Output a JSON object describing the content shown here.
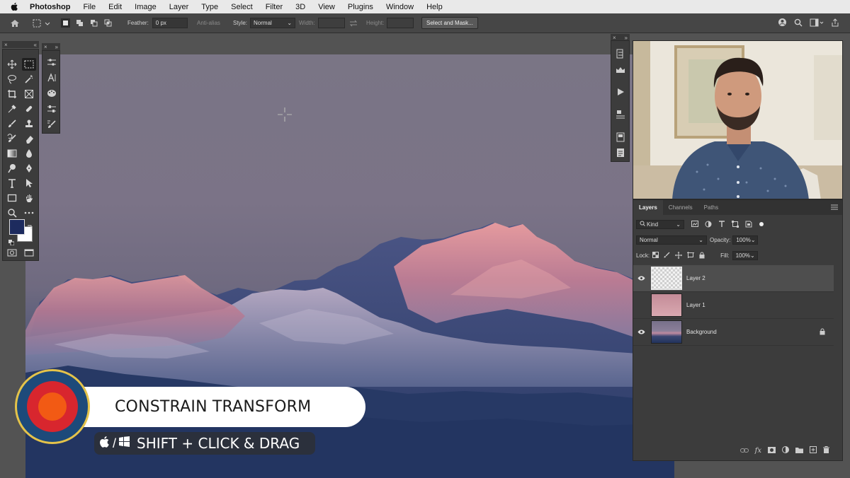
{
  "menubar": {
    "app_name": "Photoshop",
    "items": [
      "File",
      "Edit",
      "Image",
      "Layer",
      "Type",
      "Select",
      "Filter",
      "3D",
      "View",
      "Plugins",
      "Window",
      "Help"
    ]
  },
  "options_bar": {
    "feather_label": "Feather:",
    "feather_value": "0 px",
    "anti_alias_label": "Anti-alias",
    "style_label": "Style:",
    "style_value": "Normal",
    "width_label": "Width:",
    "height_label": "Height:",
    "select_mask_label": "Select and Mask..."
  },
  "tools": {
    "left_column": [
      "move-tool",
      "lasso-tool",
      "crop-tool",
      "eyedropper-tool",
      "brush-tool",
      "history-brush-tool",
      "gradient-tool",
      "dodge-tool",
      "type-tool",
      "rectangle-tool",
      "zoom-tool"
    ],
    "right_column": [
      "marquee-tool",
      "magic-wand-tool",
      "frame-tool",
      "healing-brush-tool",
      "clone-stamp-tool",
      "eraser-tool",
      "blur-tool",
      "pen-tool",
      "path-selection-tool",
      "hand-tool",
      "more-tools"
    ],
    "foreground_color": "#1d2b5e",
    "background_color": "#ffffff"
  },
  "layers_panel": {
    "tabs": [
      "Layers",
      "Channels",
      "Paths"
    ],
    "active_tab": "Layers",
    "filter_value": "Kind",
    "blend_mode": "Normal",
    "opacity_label": "Opacity:",
    "opacity_value": "100%",
    "lock_label": "Lock:",
    "fill_label": "Fill:",
    "fill_value": "100%",
    "layers": [
      {
        "name": "Layer 2",
        "visible": true,
        "selected": true,
        "locked": false
      },
      {
        "name": "Layer 1",
        "visible": false,
        "selected": false,
        "locked": false
      },
      {
        "name": "Background",
        "visible": true,
        "selected": false,
        "locked": true
      }
    ]
  },
  "overlay": {
    "title": "CONSTRAIN TRANSFORM",
    "shortcut": "SHIFT + CLICK & DRAG",
    "platform_separator": "/"
  },
  "colors": {
    "accent_target_outer": "#1d4a7a",
    "accent_target_ring": "#d8262e",
    "accent_target_center": "#f25a14",
    "accent_target_border": "#e4c34a"
  }
}
